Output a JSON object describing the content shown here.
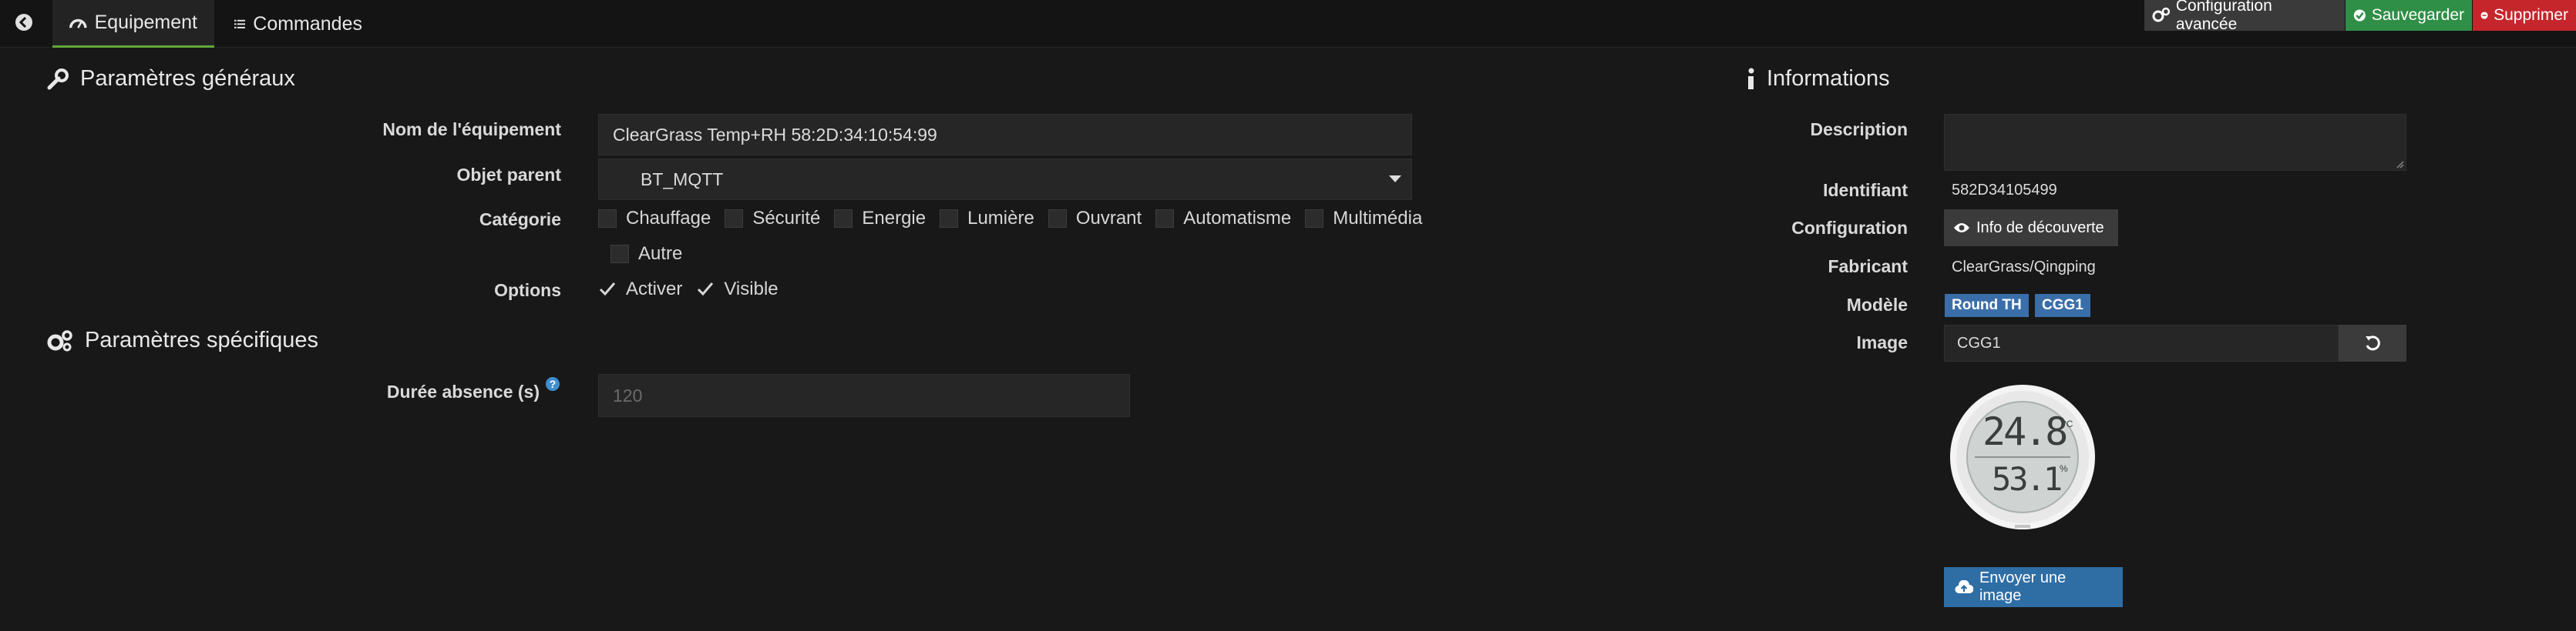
{
  "tabs": {
    "equipment": "Equipement",
    "commands": "Commandes"
  },
  "actions": {
    "advanced_config": "Configuration avancée",
    "save": "Sauvegarder",
    "delete": "Supprimer"
  },
  "general": {
    "title": "Paramètres généraux",
    "name_label": "Nom de l'équipement",
    "name_value": "ClearGrass Temp+RH 58:2D:34:10:54:99",
    "parent_label": "Objet parent",
    "parent_value": "BT_MQTT",
    "category_label": "Catégorie",
    "categories": [
      "Chauffage",
      "Sécurité",
      "Energie",
      "Lumière",
      "Ouvrant",
      "Automatisme",
      "Multimédia",
      "Autre"
    ],
    "options_label": "Options",
    "options": [
      "Activer",
      "Visible"
    ]
  },
  "specific": {
    "title": "Paramètres spécifiques",
    "absence_label": "Durée absence (s)",
    "absence_placeholder": "120",
    "help_symbol": "?"
  },
  "info": {
    "title": "Informations",
    "description_label": "Description",
    "description_value": "",
    "identifier_label": "Identifiant",
    "identifier_value": "582D34105499",
    "configuration_label": "Configuration",
    "discovery_button": "Info de découverte",
    "manufacturer_label": "Fabricant",
    "manufacturer_value": "ClearGrass/Qingping",
    "model_label": "Modèle",
    "model_badges": [
      "Round TH",
      "CGG1"
    ],
    "image_label": "Image",
    "image_value": "CGG1",
    "device_temp": "24.8",
    "device_temp_unit": "°C",
    "device_hum": "53.1",
    "device_hum_unit": "%",
    "upload_button": "Envoyer une image"
  },
  "colors": {
    "background": "#181818",
    "save": "#2f8f46",
    "delete": "#c5262c",
    "badge": "#3a6ea8",
    "tab_underline": "#5fa83a"
  }
}
